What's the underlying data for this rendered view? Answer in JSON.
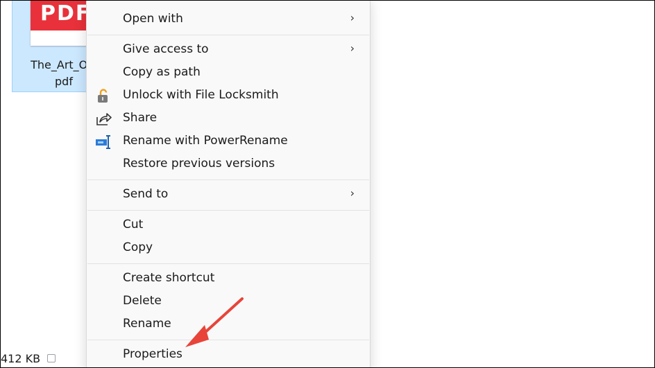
{
  "file": {
    "icon_text": "PDF",
    "name_line1": "The_Art_Of_",
    "name_line2": "pdf"
  },
  "status_bar": {
    "size": "412 KB"
  },
  "context_menu": {
    "open_with": "Open with",
    "give_access": "Give access to",
    "copy_as_path": "Copy as path",
    "unlock_locksmith": "Unlock with File Locksmith",
    "share": "Share",
    "rename_powerrename": "Rename with PowerRename",
    "restore_versions": "Restore previous versions",
    "send_to": "Send to",
    "cut": "Cut",
    "copy": "Copy",
    "create_shortcut": "Create shortcut",
    "delete": "Delete",
    "rename": "Rename",
    "properties": "Properties",
    "chevron": "›"
  },
  "colors": {
    "pdf_red": "#e8313a",
    "selection": "#cce8ff",
    "annotation_arrow": "#e8443a"
  }
}
